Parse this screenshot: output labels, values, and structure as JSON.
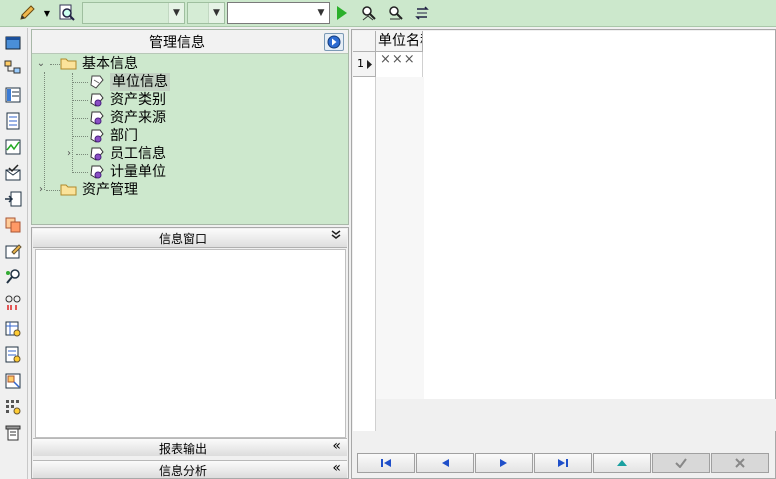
{
  "toolbar": {
    "combo1_value": "",
    "combo2_value": "",
    "combo3_value": ""
  },
  "tree": {
    "title": "管理信息",
    "items": [
      {
        "label": "基本信息"
      },
      {
        "label": "单位信息"
      },
      {
        "label": "资产类别"
      },
      {
        "label": "资产来源"
      },
      {
        "label": "部门"
      },
      {
        "label": "员工信息"
      },
      {
        "label": "计量单位"
      },
      {
        "label": "资产管理"
      }
    ]
  },
  "info_window": {
    "title": "信息窗口",
    "collapse_glyph": "»",
    "bars": [
      {
        "label": "报表输出",
        "glyph": "«"
      },
      {
        "label": "信息分析",
        "glyph": "«"
      }
    ]
  },
  "grid": {
    "column_header": "单位名称",
    "row_number": "1",
    "cell_value": "×××"
  },
  "colors": {
    "toolbar_bg": "#cce8cc",
    "tree_bg": "#cde8cd",
    "play_green": "#2bb02b",
    "nav_blue": "#1f4fc9"
  }
}
